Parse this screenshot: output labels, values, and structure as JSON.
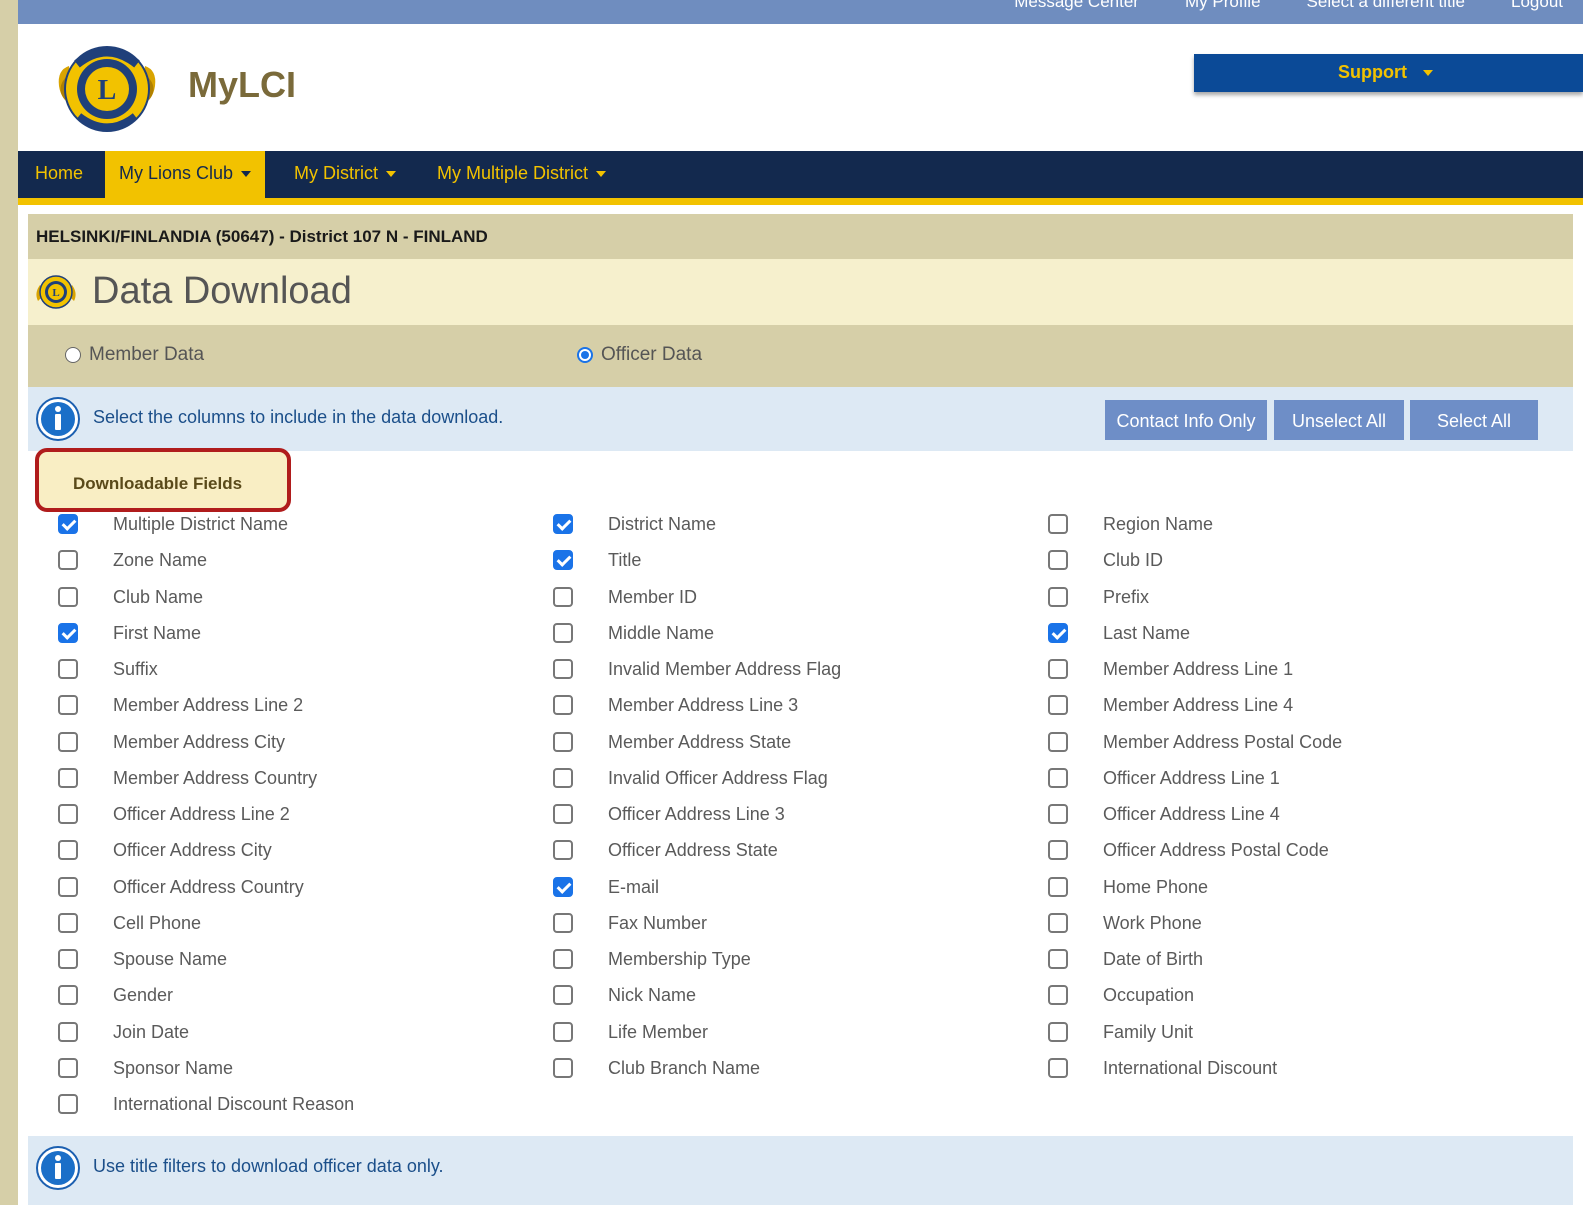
{
  "top_links": [
    "Message Center",
    "My Profile",
    "Select a different title",
    "Logout"
  ],
  "brand": {
    "name": "MyLCI",
    "logo_icon": "lions-international-logo"
  },
  "support": {
    "label": "Support"
  },
  "nav": {
    "items": [
      {
        "label": "Home",
        "active": false,
        "dropdown": false
      },
      {
        "label": "My Lions Club",
        "active": true,
        "dropdown": true
      },
      {
        "label": "My District",
        "active": false,
        "dropdown": true
      },
      {
        "label": "My Multiple District",
        "active": false,
        "dropdown": true
      }
    ]
  },
  "breadcrumb": "HELSINKI/FINLANDIA (50647) - District 107 N - FINLAND",
  "page_title": "Data Download",
  "data_type": {
    "options": [
      {
        "label": "Member Data",
        "selected": false
      },
      {
        "label": "Officer Data",
        "selected": true
      }
    ]
  },
  "info": {
    "text": "Select the columns to include in the data download.",
    "buttons": [
      "Contact Info Only",
      "Unselect All",
      "Select All"
    ]
  },
  "section": {
    "label": "Downloadable Fields"
  },
  "fields": [
    {
      "label": "Multiple District Name",
      "checked": true
    },
    {
      "label": "District Name",
      "checked": true
    },
    {
      "label": "Region Name",
      "checked": false
    },
    {
      "label": "Zone Name",
      "checked": false
    },
    {
      "label": "Title",
      "checked": true
    },
    {
      "label": "Club ID",
      "checked": false
    },
    {
      "label": "Club Name",
      "checked": false
    },
    {
      "label": "Member ID",
      "checked": false
    },
    {
      "label": "Prefix",
      "checked": false
    },
    {
      "label": "First Name",
      "checked": true
    },
    {
      "label": "Middle Name",
      "checked": false
    },
    {
      "label": "Last Name",
      "checked": true
    },
    {
      "label": "Suffix",
      "checked": false
    },
    {
      "label": "Invalid Member Address Flag",
      "checked": false
    },
    {
      "label": "Member Address Line 1",
      "checked": false
    },
    {
      "label": "Member Address Line 2",
      "checked": false
    },
    {
      "label": "Member Address Line 3",
      "checked": false
    },
    {
      "label": "Member Address Line 4",
      "checked": false
    },
    {
      "label": "Member Address City",
      "checked": false
    },
    {
      "label": "Member Address State",
      "checked": false
    },
    {
      "label": "Member Address Postal Code",
      "checked": false
    },
    {
      "label": "Member Address Country",
      "checked": false
    },
    {
      "label": "Invalid Officer Address Flag",
      "checked": false
    },
    {
      "label": "Officer Address Line 1",
      "checked": false
    },
    {
      "label": "Officer Address Line 2",
      "checked": false
    },
    {
      "label": "Officer Address Line 3",
      "checked": false
    },
    {
      "label": "Officer Address Line 4",
      "checked": false
    },
    {
      "label": "Officer Address City",
      "checked": false
    },
    {
      "label": "Officer Address State",
      "checked": false
    },
    {
      "label": "Officer Address Postal Code",
      "checked": false
    },
    {
      "label": "Officer Address Country",
      "checked": false
    },
    {
      "label": "E-mail",
      "checked": true
    },
    {
      "label": "Home Phone",
      "checked": false
    },
    {
      "label": "Cell Phone",
      "checked": false
    },
    {
      "label": "Fax Number",
      "checked": false
    },
    {
      "label": "Work Phone",
      "checked": false
    },
    {
      "label": "Spouse Name",
      "checked": false
    },
    {
      "label": "Membership Type",
      "checked": false
    },
    {
      "label": "Date of Birth",
      "checked": false
    },
    {
      "label": "Gender",
      "checked": false
    },
    {
      "label": "Nick Name",
      "checked": false
    },
    {
      "label": "Occupation",
      "checked": false
    },
    {
      "label": "Join Date",
      "checked": false
    },
    {
      "label": "Life Member",
      "checked": false
    },
    {
      "label": "Family Unit",
      "checked": false
    },
    {
      "label": "Sponsor Name",
      "checked": false
    },
    {
      "label": "Club Branch Name",
      "checked": false
    },
    {
      "label": "International Discount",
      "checked": false
    },
    {
      "label": "International Discount Reason",
      "checked": false
    }
  ],
  "footer_info": {
    "text": "Use title filters to download officer data only."
  },
  "colors": {
    "navy": "#13294e",
    "gold": "#f2c200",
    "button": "#6e8ec7",
    "info_text": "#1b4f8a",
    "highlight": "#b01c1c"
  }
}
